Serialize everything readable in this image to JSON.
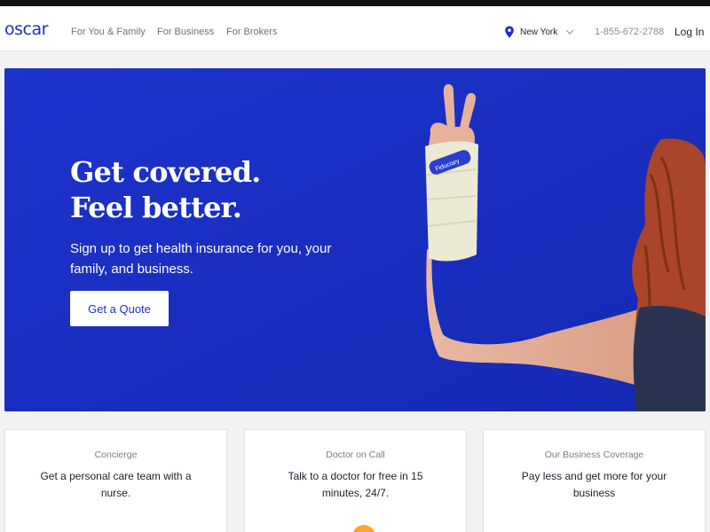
{
  "header": {
    "logo": "oscar",
    "nav": [
      "For You & Family",
      "For Business",
      "For Brokers"
    ],
    "location": {
      "label": "New York",
      "icon": "location-pin-icon"
    },
    "phone": "1-855-672-2788",
    "login": "Log In"
  },
  "hero": {
    "title_line1": "Get covered.",
    "title_line2": "Feel better.",
    "subtitle": "Sign up to get health insurance for you, your family, and business.",
    "cta": "Get a Quote",
    "cast_text": "Fiduciary"
  },
  "cards": [
    {
      "label": "Concierge",
      "text": "Get a personal care team with a nurse."
    },
    {
      "label": "Doctor on Call",
      "text": "Talk to a doctor for free in 15 minutes, 24/7."
    },
    {
      "label": "Our Business Coverage",
      "text": "Pay less and get more for your business"
    }
  ],
  "colors": {
    "brand_blue": "#1f2fc9",
    "hero_bg": "#1a31c8",
    "accent_orange": "#f4a92a"
  }
}
